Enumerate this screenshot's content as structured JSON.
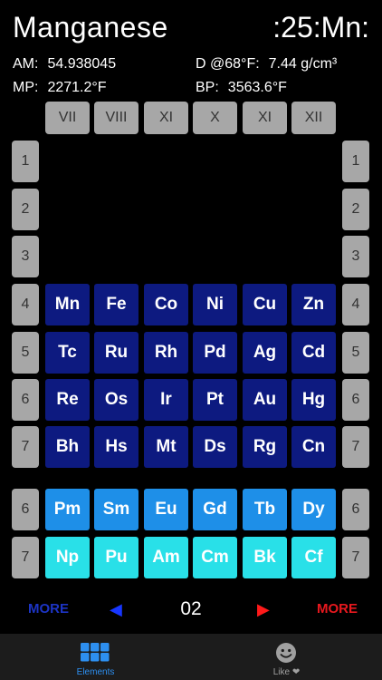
{
  "element": {
    "name": "Manganese",
    "symbol_display": ":25:Mn:",
    "am_label": "AM:",
    "am_value": "54.938045",
    "density_label": "D @68°F:",
    "density_value": "7.44 g/cm³",
    "mp_label": "MP:",
    "mp_value": "2271.2°F",
    "bp_label": "BP:",
    "bp_value": "3563.6°F"
  },
  "column_headers": [
    "VII",
    "VIII",
    "XI",
    "X",
    "XI",
    "XII"
  ],
  "row_labels": [
    "1",
    "2",
    "3",
    "4",
    "5",
    "6",
    "7"
  ],
  "lower_row_labels": [
    "6",
    "7"
  ],
  "table": [
    [
      "Mn",
      "Fe",
      "Co",
      "Ni",
      "Cu",
      "Zn"
    ],
    [
      "Tc",
      "Ru",
      "Rh",
      "Pd",
      "Ag",
      "Cd"
    ],
    [
      "Re",
      "Os",
      "Ir",
      "Pt",
      "Au",
      "Hg"
    ],
    [
      "Bh",
      "Hs",
      "Mt",
      "Ds",
      "Rg",
      "Cn"
    ]
  ],
  "lower_table": [
    [
      "Pm",
      "Sm",
      "Eu",
      "Gd",
      "Tb",
      "Dy"
    ],
    [
      "Np",
      "Pu",
      "Am",
      "Cm",
      "Bk",
      "Cf"
    ]
  ],
  "nav": {
    "more_left": "MORE",
    "prev_arrow": "◀",
    "page": "02",
    "next_arrow": "▶",
    "more_right": "MORE"
  },
  "tabs": [
    {
      "label": "Elements",
      "icon": "grid-icon",
      "active": true
    },
    {
      "label": "Like ❤",
      "icon": "smiley-icon",
      "active": false
    }
  ],
  "colors": {
    "transition_metal": "#0d1a80",
    "lanthanide": "#1e8fe8",
    "actinide": "#29e0e8",
    "label_gray": "#a7a7a7",
    "more_left": "#1c34c4",
    "prev_arrow": "#1736ff",
    "more_right": "#e8181e",
    "next_arrow": "#ff1a1a",
    "tab_active": "#2d8ff0",
    "tab_inactive": "#a0a0a0"
  }
}
